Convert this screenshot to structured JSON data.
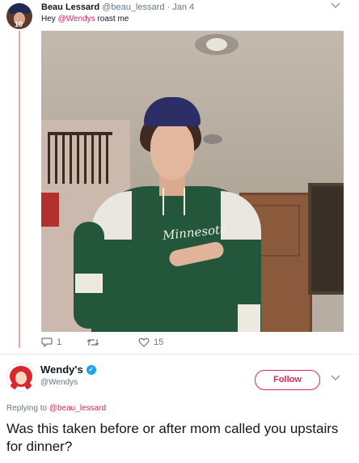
{
  "original_tweet": {
    "author_name": "Beau Lessard",
    "handle": "@beau_lessard",
    "separator": "·",
    "date": "Jan 4",
    "text_prefix": "Hey ",
    "mention": "@Wendys",
    "text_suffix": " roast me",
    "avatar_number": "10",
    "photo_logo_text": "Minnesota",
    "actions": {
      "reply_count": "1",
      "retweet_count": "",
      "like_count": "15"
    }
  },
  "reply_tweet": {
    "author_name": "Wendy's",
    "handle": "@Wendys",
    "follow_label": "Follow",
    "replying_prefix": "Replying to ",
    "replying_handle": "@beau_lessard",
    "text": "Was this taken before or after mom called you upstairs for dinner?"
  },
  "colors": {
    "accent": "#e0245e",
    "muted": "#657786",
    "verified": "#1da1f2",
    "thread_line": "#f4a5a5"
  },
  "icons": [
    "reply-icon",
    "retweet-icon",
    "like-icon",
    "chevron-down-icon",
    "verified-badge-icon"
  ]
}
